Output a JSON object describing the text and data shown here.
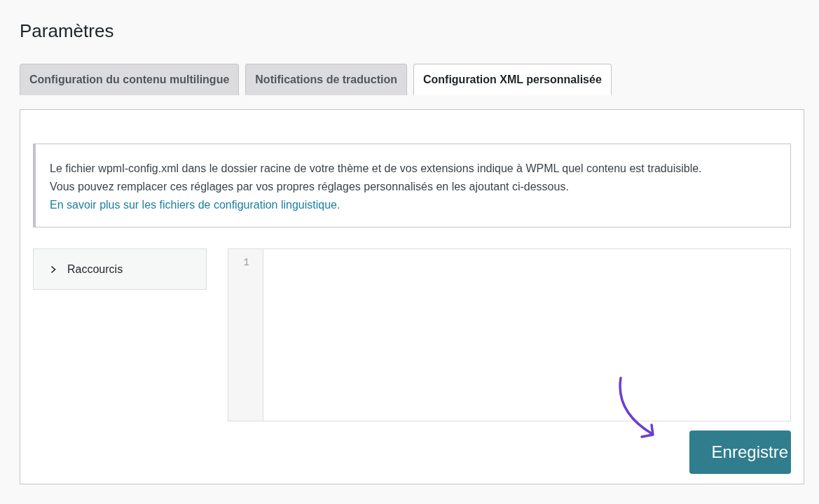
{
  "page": {
    "title": "Paramètres"
  },
  "tabs": [
    {
      "label": "Configuration du contenu multilingue",
      "selected": false
    },
    {
      "label": "Notifications de traduction",
      "selected": false
    },
    {
      "label": "Configuration XML personnalisée",
      "selected": true
    }
  ],
  "notice": {
    "lines": [
      "Le fichier wpml-config.xml dans le dossier racine de votre thème et de vos extensions indique à WPML quel contenu est traduisible.",
      "Vous pouvez remplacer ces réglages par vos propres réglages personnalisés en les ajoutant ci-dessous."
    ],
    "link": "En savoir plus sur les fichiers de configuration linguistique."
  },
  "shortcuts": {
    "label": "Raccourcis",
    "expanded": false
  },
  "editor": {
    "line_numbers": [
      "1"
    ]
  },
  "save_button": {
    "label": "Enregistre"
  }
}
